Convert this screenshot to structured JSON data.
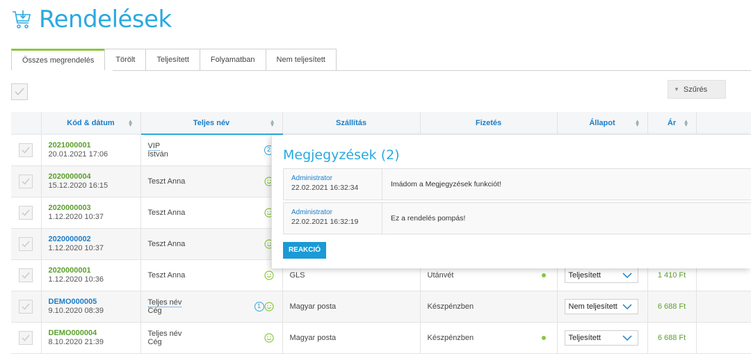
{
  "page": {
    "title": "Rendelések"
  },
  "tabs": [
    {
      "label": "Összes megrendelés"
    },
    {
      "label": "Törölt"
    },
    {
      "label": "Teljesített"
    },
    {
      "label": "Folyamatban"
    },
    {
      "label": "Nem teljesített"
    }
  ],
  "filter": {
    "label": "Szűrés"
  },
  "columns": {
    "code_date": "Kód & dátum",
    "full_name": "Teljes név",
    "shipping": "Szállítás",
    "payment": "Fizetés",
    "status": "Állapot",
    "price": "Ár"
  },
  "rows": [
    {
      "code": "2021000001",
      "date": "20.01.2021 17:06",
      "name1": "VIP",
      "name2": "István",
      "shipping": "",
      "payment": "",
      "status": "",
      "price": "",
      "badge": "2"
    },
    {
      "code": "2020000004",
      "date": "15.12.2020 16:15",
      "name1": "Teszt Anna",
      "name2": "",
      "shipping": "",
      "payment": "",
      "status": "",
      "price": ""
    },
    {
      "code": "2020000003",
      "date": "1.12.2020 10:37",
      "name1": "Teszt Anna",
      "name2": "",
      "shipping": "",
      "payment": "",
      "status": "",
      "price": ""
    },
    {
      "code": "2020000002",
      "date": "1.12.2020 10:37",
      "name1": "Teszt Anna",
      "name2": "",
      "shipping": "",
      "payment": "",
      "status": "",
      "price": ""
    },
    {
      "code": "2020000001",
      "date": "1.12.2020 10:36",
      "name1": "Teszt Anna",
      "name2": "",
      "shipping": "GLS",
      "payment": "Utánvét",
      "status": "Teljesített",
      "price": "1 410 Ft"
    },
    {
      "code": "DEMO000005",
      "date": "9.10.2020 08:39",
      "name1": "Teljes név",
      "name2": "Cég",
      "shipping": "Magyar posta",
      "payment": "Készpénzben",
      "status": "Nem teljesített",
      "price": "6 688 Ft",
      "badge": "1"
    },
    {
      "code": "DEMO000004",
      "date": "8.10.2020 21:39",
      "name1": "Teljes név",
      "name2": "Cég",
      "shipping": "Magyar posta",
      "payment": "Készpénzben",
      "status": "Teljesített",
      "price": "6 688 Ft"
    }
  ],
  "notes_popup": {
    "title": "Megjegyzések (2)",
    "notes": [
      {
        "author": "Administrator",
        "date": "22.02.2021 16:32:34",
        "text": "Imádom a Megjegyzések funkciót!"
      },
      {
        "author": "Administrator",
        "date": "22.02.2021 16:32:19",
        "text": "Ez a rendelés pompás!"
      }
    ],
    "button": "REAKCIÓ"
  },
  "colors": {
    "accent": "#29a9e0",
    "green": "#5aa02c",
    "blue": "#1a7dc8",
    "tab_active": "#8cc63f"
  }
}
